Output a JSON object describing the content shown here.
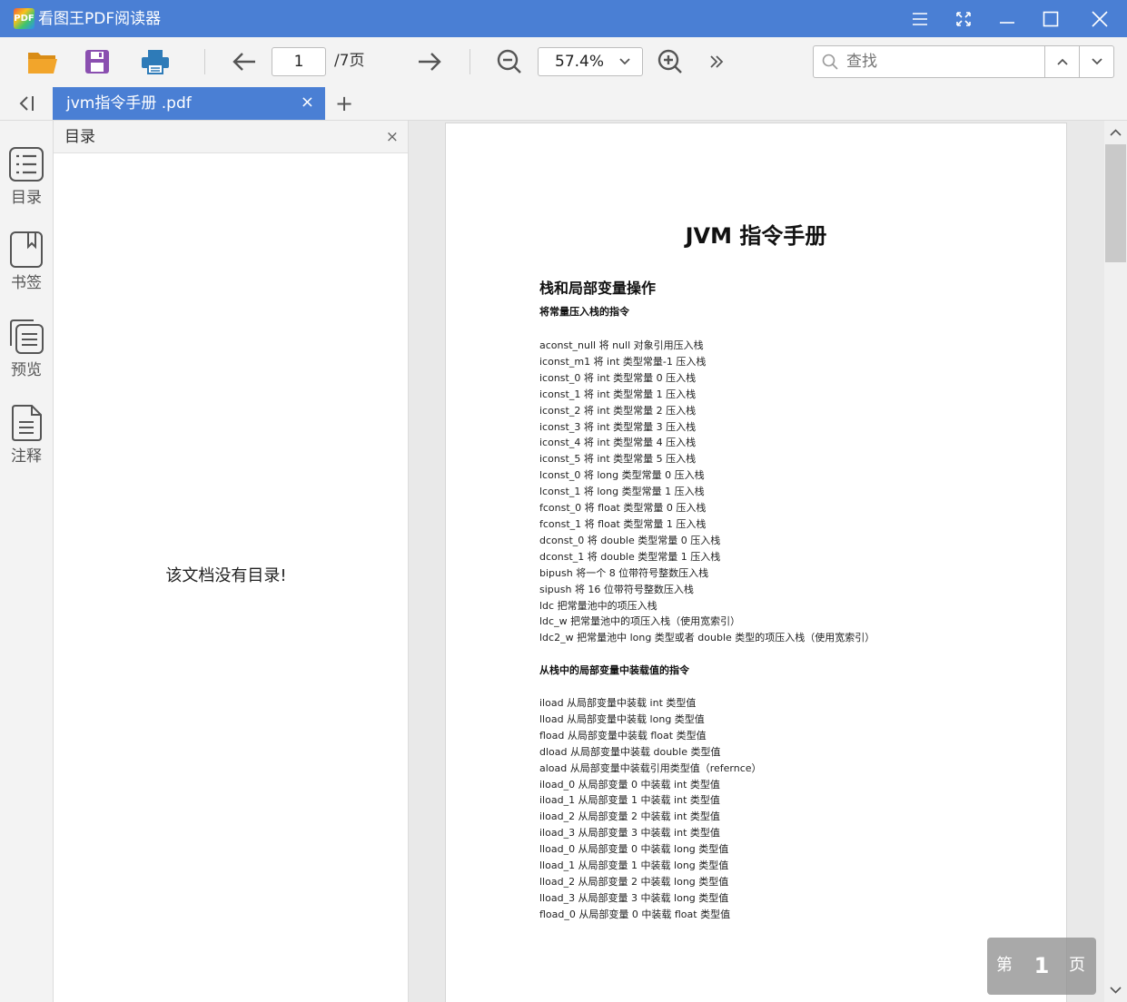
{
  "app": {
    "logo_text": "PDF",
    "title": "看图王PDF阅读器"
  },
  "toolbar": {
    "page_current": "1",
    "page_total": "/7页",
    "zoom": "57.4%",
    "search_placeholder": "查找"
  },
  "tab": {
    "label": "jvm指令手册 .pdf",
    "close": "×",
    "add": "+"
  },
  "rail": {
    "items": [
      {
        "label": "目录",
        "icon": "toc-icon"
      },
      {
        "label": "书签",
        "icon": "bookmark-icon"
      },
      {
        "label": "预览",
        "icon": "thumbnail-icon"
      },
      {
        "label": "注释",
        "icon": "annotation-icon"
      }
    ]
  },
  "panel": {
    "title": "目录",
    "close": "×",
    "empty_message": "该文档没有目录!"
  },
  "document": {
    "title": "JVM 指令手册",
    "section_title": "栈和局部变量操作",
    "subsection1": "将常量压入栈的指令",
    "lines1": [
      "aconst_null  将 null 对象引用压入栈",
      "iconst_m1  将 int 类型常量-1 压入栈",
      "iconst_0  将 int 类型常量 0 压入栈",
      "iconst_1  将 int 类型常量 1 压入栈",
      "iconst_2  将 int 类型常量 2 压入栈",
      "iconst_3  将 int 类型常量 3 压入栈",
      "iconst_4  将 int 类型常量 4 压入栈",
      "iconst_5  将 int 类型常量 5 压入栈",
      "lconst_0  将 long 类型常量 0 压入栈",
      "lconst_1  将 long 类型常量 1 压入栈",
      "fconst_0  将 float 类型常量 0 压入栈",
      "fconst_1  将 float 类型常量 1 压入栈",
      "dconst_0  将 double 类型常量 0 压入栈",
      "dconst_1  将 double 类型常量 1 压入栈",
      "bipush  将一个 8 位带符号整数压入栈",
      "sipush  将 16 位带符号整数压入栈",
      "ldc  把常量池中的项压入栈",
      "ldc_w  把常量池中的项压入栈（使用宽索引）",
      "ldc2_w  把常量池中 long 类型或者 double 类型的项压入栈（使用宽索引）"
    ],
    "subsection2": "从栈中的局部变量中装载值的指令",
    "lines2": [
      "iload  从局部变量中装载 int 类型值",
      "lload  从局部变量中装载 long 类型值",
      "fload  从局部变量中装载 float 类型值",
      "dload  从局部变量中装载 double 类型值",
      "aload  从局部变量中装载引用类型值（refernce）",
      "iload_0  从局部变量 0 中装载 int 类型值",
      "iload_1  从局部变量 1 中装载 int 类型值",
      "iload_2  从局部变量 2 中装载 int 类型值",
      "iload_3  从局部变量 3 中装载 int 类型值",
      "lload_0  从局部变量 0 中装载 long 类型值",
      "lload_1  从局部变量 1 中装载 long 类型值",
      "lload_2  从局部变量 2 中装载 long 类型值",
      "lload_3  从局部变量 3 中装载 long 类型值",
      "fload_0  从局部变量 0 中装载 float 类型值"
    ]
  },
  "page_indicator": {
    "prefix": "第",
    "number": "1",
    "suffix": "页"
  },
  "colors": {
    "accent": "#4a7fd4",
    "open_folder": "#f2a52b",
    "save": "#8a4fb0",
    "print": "#2e7bb8"
  }
}
